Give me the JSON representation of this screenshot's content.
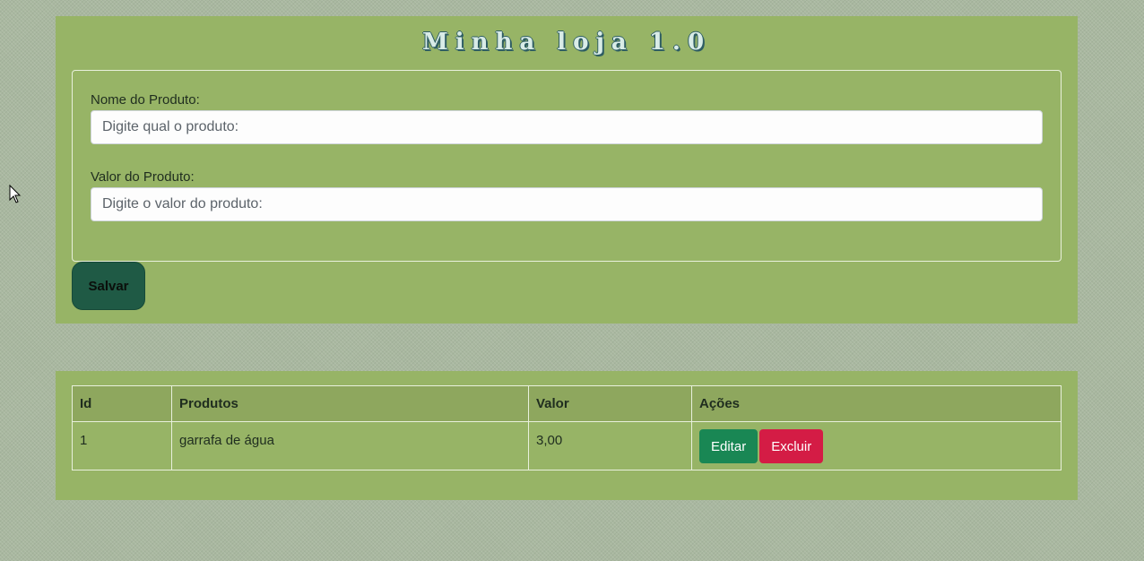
{
  "app": {
    "title": "Minha loja 1.0"
  },
  "form": {
    "name_label": "Nome do Produto:",
    "name_placeholder": "Digite qual o produto:",
    "name_value": "",
    "value_label": "Valor do Produto:",
    "value_placeholder": "Digite o valor do produto:",
    "value_value": "",
    "save_label": "Salvar"
  },
  "table": {
    "headers": [
      "Id",
      "Produtos",
      "Valor",
      "Ações"
    ],
    "rows": [
      {
        "id": "1",
        "product": "garrafa de água",
        "value": "3,00",
        "edit_label": "Editar",
        "delete_label": "Excluir"
      }
    ]
  },
  "colors": {
    "page_background": "#a9b8a0",
    "panel": "#97b466",
    "save_button": "#1f5a45",
    "edit_button": "#198754",
    "delete_button": "#d41c45"
  }
}
